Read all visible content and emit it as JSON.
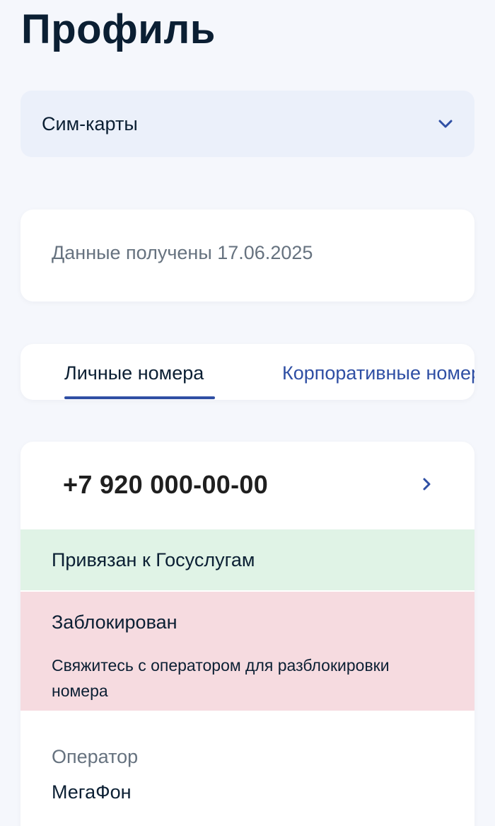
{
  "page": {
    "title": "Профиль"
  },
  "dropdown": {
    "label": "Сим-карты",
    "icon": "chevron-down-icon"
  },
  "info": {
    "text": "Данные получены 17.06.2025"
  },
  "tabs": [
    {
      "label": "Личные номера",
      "active": true
    },
    {
      "label": "Корпоративные номера",
      "active": false
    }
  ],
  "number": {
    "phone": "+7 920 000-00-00",
    "icon": "chevron-right-icon",
    "linked_status": "Привязан к Госуслугам",
    "blocked_title": "Заблокирован",
    "blocked_description": "Свяжитесь с оператором для разблокировки номера",
    "operator_label": "Оператор",
    "operator_value": "МегаФон"
  },
  "colors": {
    "accent": "#2f4fa4",
    "linked_bg": "#e0f3e6",
    "blocked_bg": "#f6dbe0",
    "page_bg": "#f5f7fc",
    "dropdown_bg": "#ebf0fa"
  }
}
